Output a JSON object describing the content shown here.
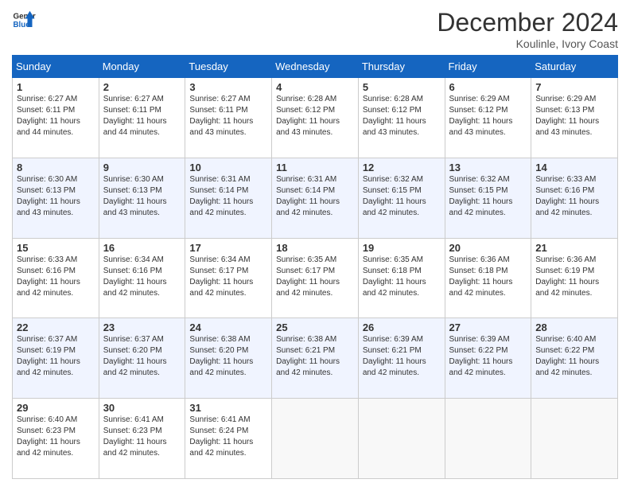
{
  "header": {
    "logo_line1": "General",
    "logo_line2": "Blue",
    "title": "December 2024",
    "subtitle": "Koulinle, Ivory Coast"
  },
  "days_of_week": [
    "Sunday",
    "Monday",
    "Tuesday",
    "Wednesday",
    "Thursday",
    "Friday",
    "Saturday"
  ],
  "weeks": [
    [
      {
        "day": "1",
        "sunrise": "6:27 AM",
        "sunset": "6:11 PM",
        "daylight": "11 hours and 44 minutes."
      },
      {
        "day": "2",
        "sunrise": "6:27 AM",
        "sunset": "6:11 PM",
        "daylight": "11 hours and 44 minutes."
      },
      {
        "day": "3",
        "sunrise": "6:27 AM",
        "sunset": "6:11 PM",
        "daylight": "11 hours and 43 minutes."
      },
      {
        "day": "4",
        "sunrise": "6:28 AM",
        "sunset": "6:12 PM",
        "daylight": "11 hours and 43 minutes."
      },
      {
        "day": "5",
        "sunrise": "6:28 AM",
        "sunset": "6:12 PM",
        "daylight": "11 hours and 43 minutes."
      },
      {
        "day": "6",
        "sunrise": "6:29 AM",
        "sunset": "6:12 PM",
        "daylight": "11 hours and 43 minutes."
      },
      {
        "day": "7",
        "sunrise": "6:29 AM",
        "sunset": "6:13 PM",
        "daylight": "11 hours and 43 minutes."
      }
    ],
    [
      {
        "day": "8",
        "sunrise": "6:30 AM",
        "sunset": "6:13 PM",
        "daylight": "11 hours and 43 minutes."
      },
      {
        "day": "9",
        "sunrise": "6:30 AM",
        "sunset": "6:13 PM",
        "daylight": "11 hours and 43 minutes."
      },
      {
        "day": "10",
        "sunrise": "6:31 AM",
        "sunset": "6:14 PM",
        "daylight": "11 hours and 42 minutes."
      },
      {
        "day": "11",
        "sunrise": "6:31 AM",
        "sunset": "6:14 PM",
        "daylight": "11 hours and 42 minutes."
      },
      {
        "day": "12",
        "sunrise": "6:32 AM",
        "sunset": "6:15 PM",
        "daylight": "11 hours and 42 minutes."
      },
      {
        "day": "13",
        "sunrise": "6:32 AM",
        "sunset": "6:15 PM",
        "daylight": "11 hours and 42 minutes."
      },
      {
        "day": "14",
        "sunrise": "6:33 AM",
        "sunset": "6:16 PM",
        "daylight": "11 hours and 42 minutes."
      }
    ],
    [
      {
        "day": "15",
        "sunrise": "6:33 AM",
        "sunset": "6:16 PM",
        "daylight": "11 hours and 42 minutes."
      },
      {
        "day": "16",
        "sunrise": "6:34 AM",
        "sunset": "6:16 PM",
        "daylight": "11 hours and 42 minutes."
      },
      {
        "day": "17",
        "sunrise": "6:34 AM",
        "sunset": "6:17 PM",
        "daylight": "11 hours and 42 minutes."
      },
      {
        "day": "18",
        "sunrise": "6:35 AM",
        "sunset": "6:17 PM",
        "daylight": "11 hours and 42 minutes."
      },
      {
        "day": "19",
        "sunrise": "6:35 AM",
        "sunset": "6:18 PM",
        "daylight": "11 hours and 42 minutes."
      },
      {
        "day": "20",
        "sunrise": "6:36 AM",
        "sunset": "6:18 PM",
        "daylight": "11 hours and 42 minutes."
      },
      {
        "day": "21",
        "sunrise": "6:36 AM",
        "sunset": "6:19 PM",
        "daylight": "11 hours and 42 minutes."
      }
    ],
    [
      {
        "day": "22",
        "sunrise": "6:37 AM",
        "sunset": "6:19 PM",
        "daylight": "11 hours and 42 minutes."
      },
      {
        "day": "23",
        "sunrise": "6:37 AM",
        "sunset": "6:20 PM",
        "daylight": "11 hours and 42 minutes."
      },
      {
        "day": "24",
        "sunrise": "6:38 AM",
        "sunset": "6:20 PM",
        "daylight": "11 hours and 42 minutes."
      },
      {
        "day": "25",
        "sunrise": "6:38 AM",
        "sunset": "6:21 PM",
        "daylight": "11 hours and 42 minutes."
      },
      {
        "day": "26",
        "sunrise": "6:39 AM",
        "sunset": "6:21 PM",
        "daylight": "11 hours and 42 minutes."
      },
      {
        "day": "27",
        "sunrise": "6:39 AM",
        "sunset": "6:22 PM",
        "daylight": "11 hours and 42 minutes."
      },
      {
        "day": "28",
        "sunrise": "6:40 AM",
        "sunset": "6:22 PM",
        "daylight": "11 hours and 42 minutes."
      }
    ],
    [
      {
        "day": "29",
        "sunrise": "6:40 AM",
        "sunset": "6:23 PM",
        "daylight": "11 hours and 42 minutes."
      },
      {
        "day": "30",
        "sunrise": "6:41 AM",
        "sunset": "6:23 PM",
        "daylight": "11 hours and 42 minutes."
      },
      {
        "day": "31",
        "sunrise": "6:41 AM",
        "sunset": "6:24 PM",
        "daylight": "11 hours and 42 minutes."
      },
      null,
      null,
      null,
      null
    ]
  ]
}
